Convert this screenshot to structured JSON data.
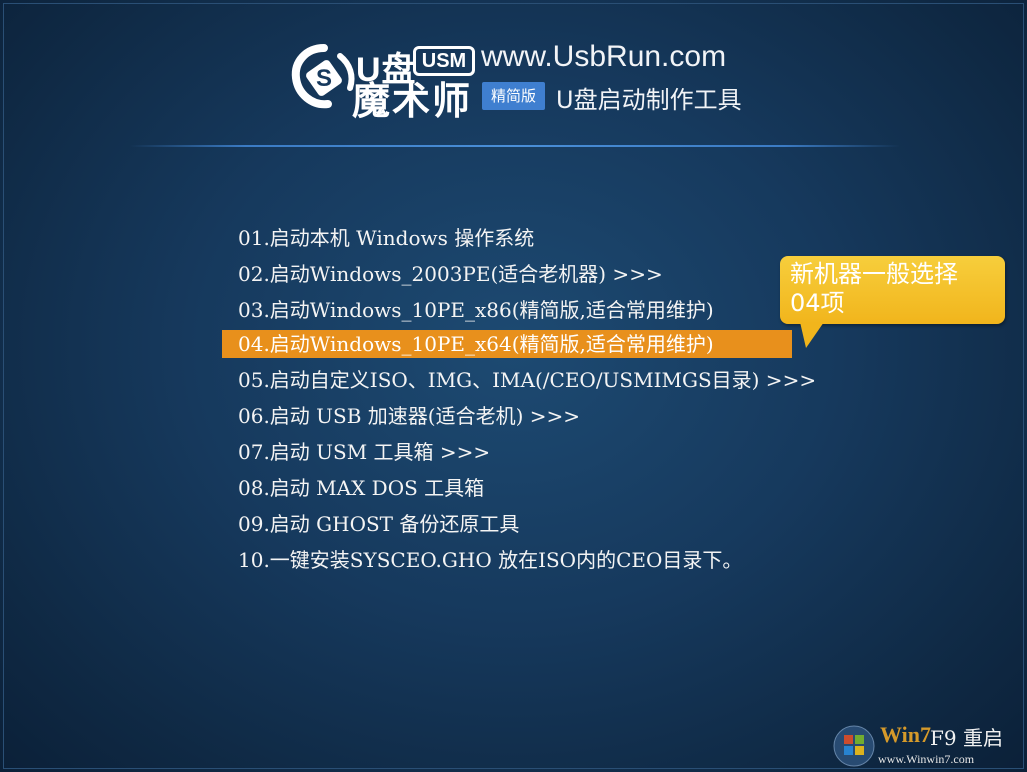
{
  "header": {
    "logo_u": "U盘",
    "logo_usm": "USM",
    "logo_name": "魔术师",
    "site_url": "www.UsbRun.com",
    "edition_badge": "精简版",
    "subtitle": "U盘启动制作工具"
  },
  "menu": {
    "selected_index": 3,
    "items": [
      "01.启动本机 Windows 操作系统",
      "02.启动Windows_2003PE(适合老机器) >>>",
      "03.启动Windows_10PE_x86(精简版,适合常用维护)",
      "04.启动Windows_10PE_x64(精简版,适合常用维护)",
      "05.启动自定义ISO、IMG、IMA(/CEO/USMIMGS目录) >>>",
      "06.启动 USB 加速器(适合老机) >>>",
      "07.启动 USM 工具箱 >>>",
      "08.启动 MAX DOS 工具箱",
      "09.启动 GHOST 备份还原工具",
      "10.一键安装SYSCEO.GHO 放在ISO内的CEO目录下。"
    ]
  },
  "callout": {
    "text": "新机器一般选择\n04项"
  },
  "footer": {
    "hint": "F9 重启"
  },
  "watermark": {
    "text": "Win7",
    "url": "www.Winwin7.com"
  },
  "colors": {
    "background": "#16395d",
    "highlight": "#e8901c",
    "callout": "#f1b51c",
    "badge": "#3f7fd0"
  }
}
